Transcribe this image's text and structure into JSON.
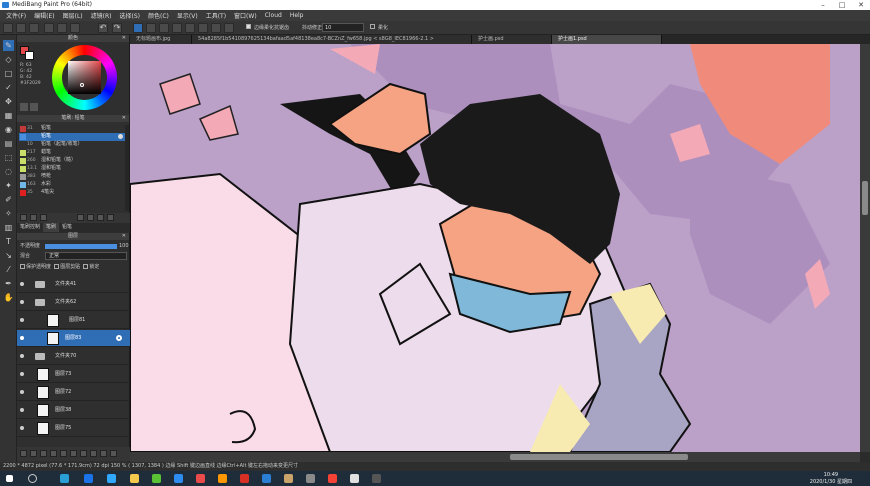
{
  "window": {
    "title": "MediBang Paint Pro (64bit)"
  },
  "menu": [
    "文件(F)",
    "编辑(E)",
    "图层(L)",
    "滤镜(R)",
    "选择(S)",
    "颜色(C)",
    "显示(V)",
    "工具(T)",
    "窗口(W)",
    "Cloud",
    "Help"
  ],
  "toolbar": {
    "antialias_label": "边缘柔化抗锯齿",
    "correction_label": "抖动修正",
    "correction_value": "10",
    "alpha_label": "柔化"
  },
  "tabs": [
    {
      "label": "无标题画布.jpg",
      "active": false
    },
    {
      "label": "54a8285f1b5410897625134bafaad5af48138ea8c7-BCZnZ_fw658.jpg < s8G8_IEC81966-2.1 >",
      "active": false
    },
    {
      "label": "护士画.psd",
      "active": false
    },
    {
      "label": "护士画1.psd",
      "active": true
    }
  ],
  "color_panel": {
    "title": "颜色",
    "fg_color": "#e5484a",
    "bg_color": "#ffffff",
    "readout": [
      "R: 63",
      "G: 42",
      "B: 42",
      "#3F2029"
    ]
  },
  "brush_panel": {
    "title": "笔刷: 铅笔",
    "items": [
      {
        "num": "31",
        "name": "铅笔",
        "color": "#c23a3a",
        "selected": false
      },
      {
        "num": "",
        "name": "铅笔",
        "color": "#4a8fe0",
        "selected": true
      },
      {
        "num": "10",
        "name": "铅笔（起笔/收笔）",
        "color": "#303030",
        "selected": false
      },
      {
        "num": "217",
        "name": "蜡笔",
        "color": "#c8e06a",
        "selected": false
      },
      {
        "num": "260",
        "name": "湿和铅笔（糙）",
        "color": "#c8e06a",
        "selected": false
      },
      {
        "num": "13.1",
        "name": "湿和铅笔",
        "color": "#c8e06a",
        "selected": false
      },
      {
        "num": "383",
        "name": "喷枪",
        "color": "#9a9a9a",
        "selected": false
      },
      {
        "num": "163",
        "name": "水彩",
        "color": "#6fb8e8",
        "selected": false
      },
      {
        "num": "35",
        "name": "4笔尖",
        "color": "#e02020",
        "selected": false
      }
    ],
    "tabs": [
      "笔刷控制",
      "笔刷",
      "铅笔"
    ]
  },
  "layer_panel": {
    "title": "图层",
    "opacity_label": "不透明度",
    "opacity_value": "100",
    "blend_label": "混合",
    "blend_value": "正常",
    "protect_label": "保护透明度",
    "clip_label": "图层剪贴",
    "lock_label": "锁定",
    "layers": [
      {
        "name": "文件夹41",
        "kind": "folder",
        "indent": 0,
        "selected": false
      },
      {
        "name": "文件夹62",
        "kind": "folder",
        "indent": 0,
        "selected": false
      },
      {
        "name": "图层81",
        "kind": "layer",
        "indent": 1,
        "selected": false
      },
      {
        "name": "图层83",
        "kind": "layer",
        "indent": 1,
        "selected": true
      },
      {
        "name": "文件夹70",
        "kind": "folder",
        "indent": 0,
        "selected": false
      },
      {
        "name": "图层73",
        "kind": "layer",
        "indent": 0,
        "selected": false
      },
      {
        "name": "图层72",
        "kind": "layer",
        "indent": 0,
        "selected": false
      },
      {
        "name": "图层38",
        "kind": "layer",
        "indent": 0,
        "selected": false
      },
      {
        "name": "图层75",
        "kind": "layer",
        "indent": 0,
        "selected": false
      }
    ]
  },
  "statusbar": {
    "text": "2200 * 4872 pixel   (77.6 * 171.9cm)   72 dpi   150 %   ( 1307, 1384 )   边缘 Shift 键边画直线   边缘Ctrl+Alt 键左右拖动来变更尺寸"
  },
  "taskbar": {
    "time": "10:49",
    "date": "2020/1/30 星期四"
  },
  "colors": {
    "canvas_purple": "#bba0c8",
    "accent_blue": "#2f6db5",
    "salmon": "#f08a7a"
  }
}
